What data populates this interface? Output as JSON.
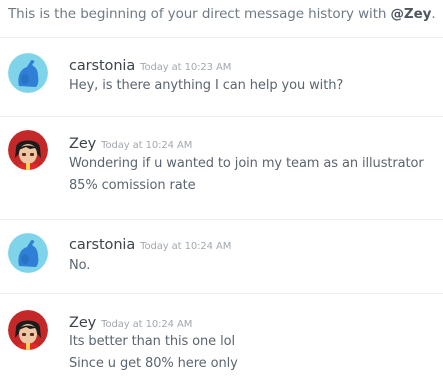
{
  "intro": {
    "prefix": "This is the beginning of your direct message history with ",
    "handle": "@Zey",
    "suffix": "."
  },
  "messages": [
    {
      "username": "carstonia",
      "timestamp": "Today at 10:23 AM",
      "avatar": "blue-blob-avatar",
      "lines": [
        "Hey, is there anything I can help you with?"
      ]
    },
    {
      "username": "Zey",
      "timestamp": "Today at 10:24 AM",
      "avatar": "anime-character-avatar",
      "lines": [
        "Wondering if u wanted to join my team as an illustrator",
        "85% comission rate"
      ]
    },
    {
      "username": "carstonia",
      "timestamp": "Today at 10:24 AM",
      "avatar": "blue-blob-avatar",
      "lines": [
        "No."
      ]
    },
    {
      "username": "Zey",
      "timestamp": "Today at 10:24 AM",
      "avatar": "anime-character-avatar",
      "lines": [
        "Its better than this one lol",
        "Since u get 80% here only"
      ]
    }
  ],
  "colors": {
    "username": "#3d444c",
    "timestamp": "#a2a8af",
    "message_text": "#5a6570",
    "divider": "#eceeef",
    "carstonia_avatar_bg": "#80d4ea",
    "carstonia_blob": "#2f7fd7",
    "zey_avatar_bg": "#c42828"
  }
}
